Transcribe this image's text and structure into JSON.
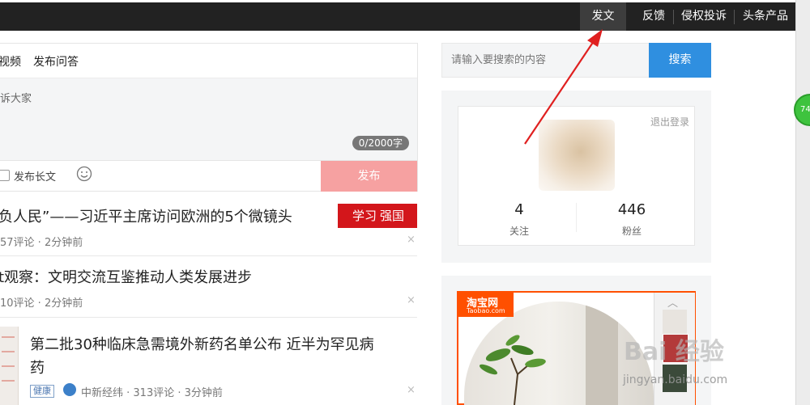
{
  "topbar": {
    "items": [
      "发文",
      "反馈",
      "侵权投诉",
      "头条产品"
    ]
  },
  "scroll_badge": "74",
  "composer": {
    "tabs": [
      "视频",
      "发布问答"
    ],
    "placeholder": "诉大家",
    "counter": "0/2000字",
    "long_article_label": "发布长文",
    "publish_label": "发布"
  },
  "feed": [
    {
      "title": "负人民”——习近平主席访问欧洲的5个微镜头",
      "meta": "57评论 · 2分钟前",
      "source_logo": {
        "script": "学习",
        "text": "强国"
      }
    },
    {
      "title": "t观察：文明交流互鉴推动人类发展进步",
      "meta": "10评论 · 2分钟前"
    },
    {
      "title_line1": "第二批30种临床急需境外新药名单公布 近半为罕见病",
      "title_line2": "药",
      "tag": "健康",
      "meta": "中新经纬 · 313评论 · 3分钟前"
    }
  ],
  "close_glyph": "×",
  "search": {
    "placeholder": "请输入要搜索的内容",
    "button_label": "搜索"
  },
  "profile": {
    "logout": "退出登录",
    "following_count": "4",
    "following_label": "关注",
    "followers_count": "446",
    "followers_label": "粉丝"
  },
  "ad": {
    "logo_name": "淘宝网",
    "logo_sub": "Taobao.com",
    "chevron": "︿"
  },
  "watermark": {
    "text": "Bai 经验",
    "url": "jingyan.baidu.com"
  },
  "colors": {
    "topbar": "#222222",
    "publish_button": "#f6a1a1",
    "search_button": "#2f8fe0",
    "taobao": "#ff5000",
    "annotation_arrow": "#e02020"
  }
}
